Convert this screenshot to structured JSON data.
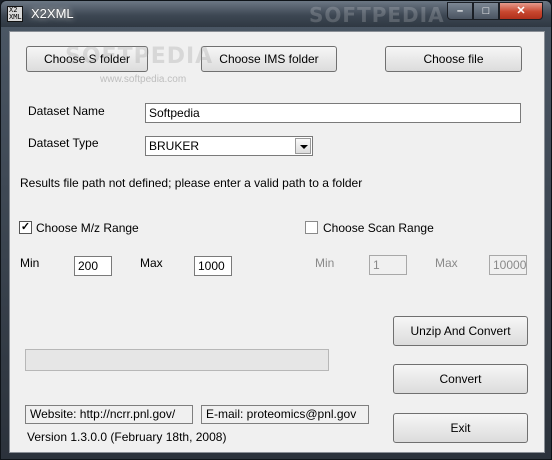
{
  "window": {
    "title": "X2XML",
    "icon_text": "X2 XML",
    "watermark": "SOFTPEDIA",
    "controls": {
      "minimize": "–",
      "maximize": "□",
      "close": "✕"
    }
  },
  "buttons": {
    "choose_s_folder": "Choose S folder",
    "choose_ims_folder": "Choose IMS folder",
    "choose_file": "Choose file",
    "unzip_convert": "Unzip And Convert",
    "convert": "Convert",
    "exit": "Exit"
  },
  "watermark": {
    "large": "SOFTPEDIA",
    "small": "www.softpedia.com"
  },
  "dataset": {
    "name_label": "Dataset Name",
    "name_value": "Softpedia",
    "type_label": "Dataset Type",
    "type_value": "BRUKER"
  },
  "status_message": "Results file path not defined; please enter a valid path to a folder",
  "mz_range": {
    "label": "Choose M/z Range",
    "checked": true,
    "check_mark": "✓",
    "min_label": "Min",
    "min_value": "200",
    "max_label": "Max",
    "max_value": "1000"
  },
  "scan_range": {
    "label": "Choose Scan Range",
    "checked": false,
    "min_label": "Min",
    "min_value": "1",
    "max_label": "Max",
    "max_value": "10000"
  },
  "progress": {
    "fraction": 0
  },
  "footer": {
    "website": "Website: http://ncrr.pnl.gov/",
    "email": "E-mail: proteomics@pnl.gov",
    "version": "Version 1.3.0.0 (February 18th, 2008)"
  },
  "colors": {
    "progress_fill": "#2fb12f",
    "close_button": "#c8472f"
  }
}
